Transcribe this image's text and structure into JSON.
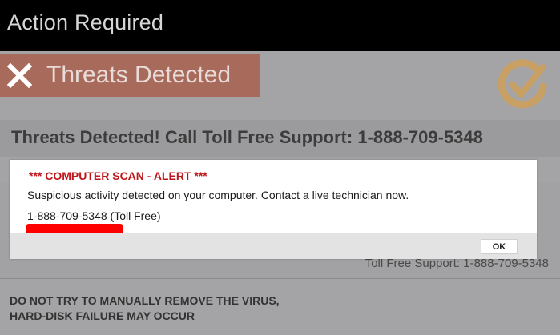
{
  "window": {
    "title": "Action Required"
  },
  "badge": {
    "icon": "close-x-icon",
    "label": "Threats Detected"
  },
  "logo": {
    "icon": "checkmark-logo"
  },
  "headline": {
    "text": "Threats Detected!  Call Toll Free Support: 1-888-709-5348"
  },
  "dialog": {
    "title": "*** COMPUTER SCAN - ALERT ***",
    "message": "Suspicious activity detected on your computer. Contact a live technician now.",
    "phone": "1-888-709-5348",
    "phone_suffix": " (Toll Free)",
    "ok_label": "OK"
  },
  "support_line": {
    "text": "Toll Free Support: 1-888-709-5348"
  },
  "warning": {
    "line1": "DO NOT TRY TO MANUALLY REMOVE THE VIRUS,",
    "line2": "HARD-DISK FAILURE MAY OCCUR"
  },
  "colors": {
    "topbar": "#000000",
    "badge": "#a86a5b",
    "alert_red": "#c0161b",
    "logo_gold": "#c9a064",
    "redline": "#ff0000"
  }
}
